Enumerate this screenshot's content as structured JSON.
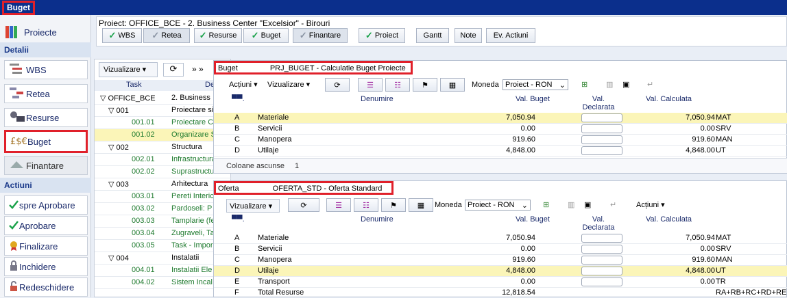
{
  "app": {
    "title": "Buget"
  },
  "sidebar": {
    "top_item": "Proiecte",
    "section_detalii": "Detalii",
    "detalii": [
      "WBS",
      "Retea",
      "Resurse",
      "Buget",
      "Finantare"
    ],
    "section_actiuni": "Actiuni",
    "actiuni": [
      "spre Aprobare",
      "Aprobare",
      "Finalizare",
      "Inchidere",
      "Redeschidere"
    ]
  },
  "project": {
    "title": "Proiect: OFFICE_BCE - 2. Business Center \"Excelsior\" - Birouri",
    "buttons": [
      "WBS",
      "Retea",
      "Resurse",
      "Buget",
      "Finantare",
      "Proiect",
      "Gantt",
      "Note",
      "Ev. Actiuni"
    ]
  },
  "taskpane": {
    "viz_label": "Vizualizare",
    "col_task": "Task",
    "col_den": "De",
    "rows": [
      {
        "code": "OFFICE_BCE",
        "name": "2. Business",
        "level": 0,
        "expand": "▽"
      },
      {
        "code": "001",
        "name": "Proiectare si",
        "level": 1,
        "expand": "▽"
      },
      {
        "code": "001.01",
        "name": "Proiectare C",
        "level": 2,
        "expand": ""
      },
      {
        "code": "001.02",
        "name": "Organizare S",
        "level": 2,
        "expand": "",
        "highlight": true
      },
      {
        "code": "002",
        "name": "Structura",
        "level": 1,
        "expand": "▽"
      },
      {
        "code": "002.01",
        "name": "Infrastructura",
        "level": 2,
        "expand": ""
      },
      {
        "code": "002.02",
        "name": "Suprastructu",
        "level": 2,
        "expand": ""
      },
      {
        "code": "003",
        "name": "Arhitectura",
        "level": 1,
        "expand": "▽"
      },
      {
        "code": "003.01",
        "name": "Pereti Interic",
        "level": 2,
        "expand": ""
      },
      {
        "code": "003.02",
        "name": "Pardoseli: P",
        "level": 2,
        "expand": ""
      },
      {
        "code": "003.03",
        "name": "Tamplarie (fe",
        "level": 2,
        "expand": ""
      },
      {
        "code": "003.04",
        "name": "Zugraveli, Ta",
        "level": 2,
        "expand": ""
      },
      {
        "code": "003.05",
        "name": "Task - Impor",
        "level": 2,
        "expand": ""
      },
      {
        "code": "004",
        "name": "Instalatii",
        "level": 1,
        "expand": "▽"
      },
      {
        "code": "004.01",
        "name": "Instalatii Ele",
        "level": 2,
        "expand": ""
      },
      {
        "code": "004.02",
        "name": "Sistem Incal",
        "level": 2,
        "expand": ""
      }
    ]
  },
  "buget": {
    "label": "Buget",
    "code_title": "PRJ_BUGET - Calculatie Buget Proiecte",
    "actiuni": "Acțiuni",
    "viz": "Vizualizare",
    "moneda_label": "Moneda",
    "moneda_value": "Proiect - RON",
    "cols": {
      "den": "Denumire",
      "vb": "Val. Buget",
      "vd": "Val. Declarata",
      "vc": "Val. Calculata"
    },
    "rows": [
      {
        "c": "A",
        "d": "Materiale",
        "vb": "7,050.94",
        "vc": "7,050.94",
        "u": "MAT",
        "hl": true
      },
      {
        "c": "B",
        "d": "Servicii",
        "vb": "0.00",
        "vc": "0.00",
        "u": "SRV"
      },
      {
        "c": "C",
        "d": "Manopera",
        "vb": "919.60",
        "vc": "919.60",
        "u": "MAN"
      },
      {
        "c": "D",
        "d": "Utilaje",
        "vb": "4,848.00",
        "vc": "4,848.00",
        "u": "UT"
      }
    ],
    "footer_label": "Coloane ascunse",
    "footer_count": "1"
  },
  "oferta": {
    "label": "Oferta",
    "code_title": "OFERTA_STD - Oferta Standard",
    "viz": "Vizualizare",
    "moneda_label": "Moneda",
    "moneda_value": "Proiect - RON",
    "actiuni": "Acțiuni",
    "cols": {
      "den": "Denumire",
      "vb": "Val. Buget",
      "vd": "Val. Declarata",
      "vc": "Val. Calculata"
    },
    "rows": [
      {
        "c": "A",
        "d": "Materiale",
        "vb": "7,050.94",
        "vc": "7,050.94",
        "u": "MAT"
      },
      {
        "c": "B",
        "d": "Servicii",
        "vb": "0.00",
        "vc": "0.00",
        "u": "SRV"
      },
      {
        "c": "C",
        "d": "Manopera",
        "vb": "919.60",
        "vc": "919.60",
        "u": "MAN"
      },
      {
        "c": "D",
        "d": "Utilaje",
        "vb": "4,848.00",
        "vc": "4,848.00",
        "u": "UT",
        "hl": true
      },
      {
        "c": "E",
        "d": "Transport",
        "vb": "0.00",
        "vc": "0.00",
        "u": "TR"
      },
      {
        "c": "F",
        "d": "Total Resurse",
        "vb": "12,818.54",
        "vc": "",
        "u": "RA+RB+RC+RD+RE"
      }
    ]
  },
  "colors": {
    "topbar": "#0b2f8c",
    "highlight": "#e0202a",
    "yellow_row": "#fbf5b8",
    "green_text": "#1e7a2e"
  }
}
